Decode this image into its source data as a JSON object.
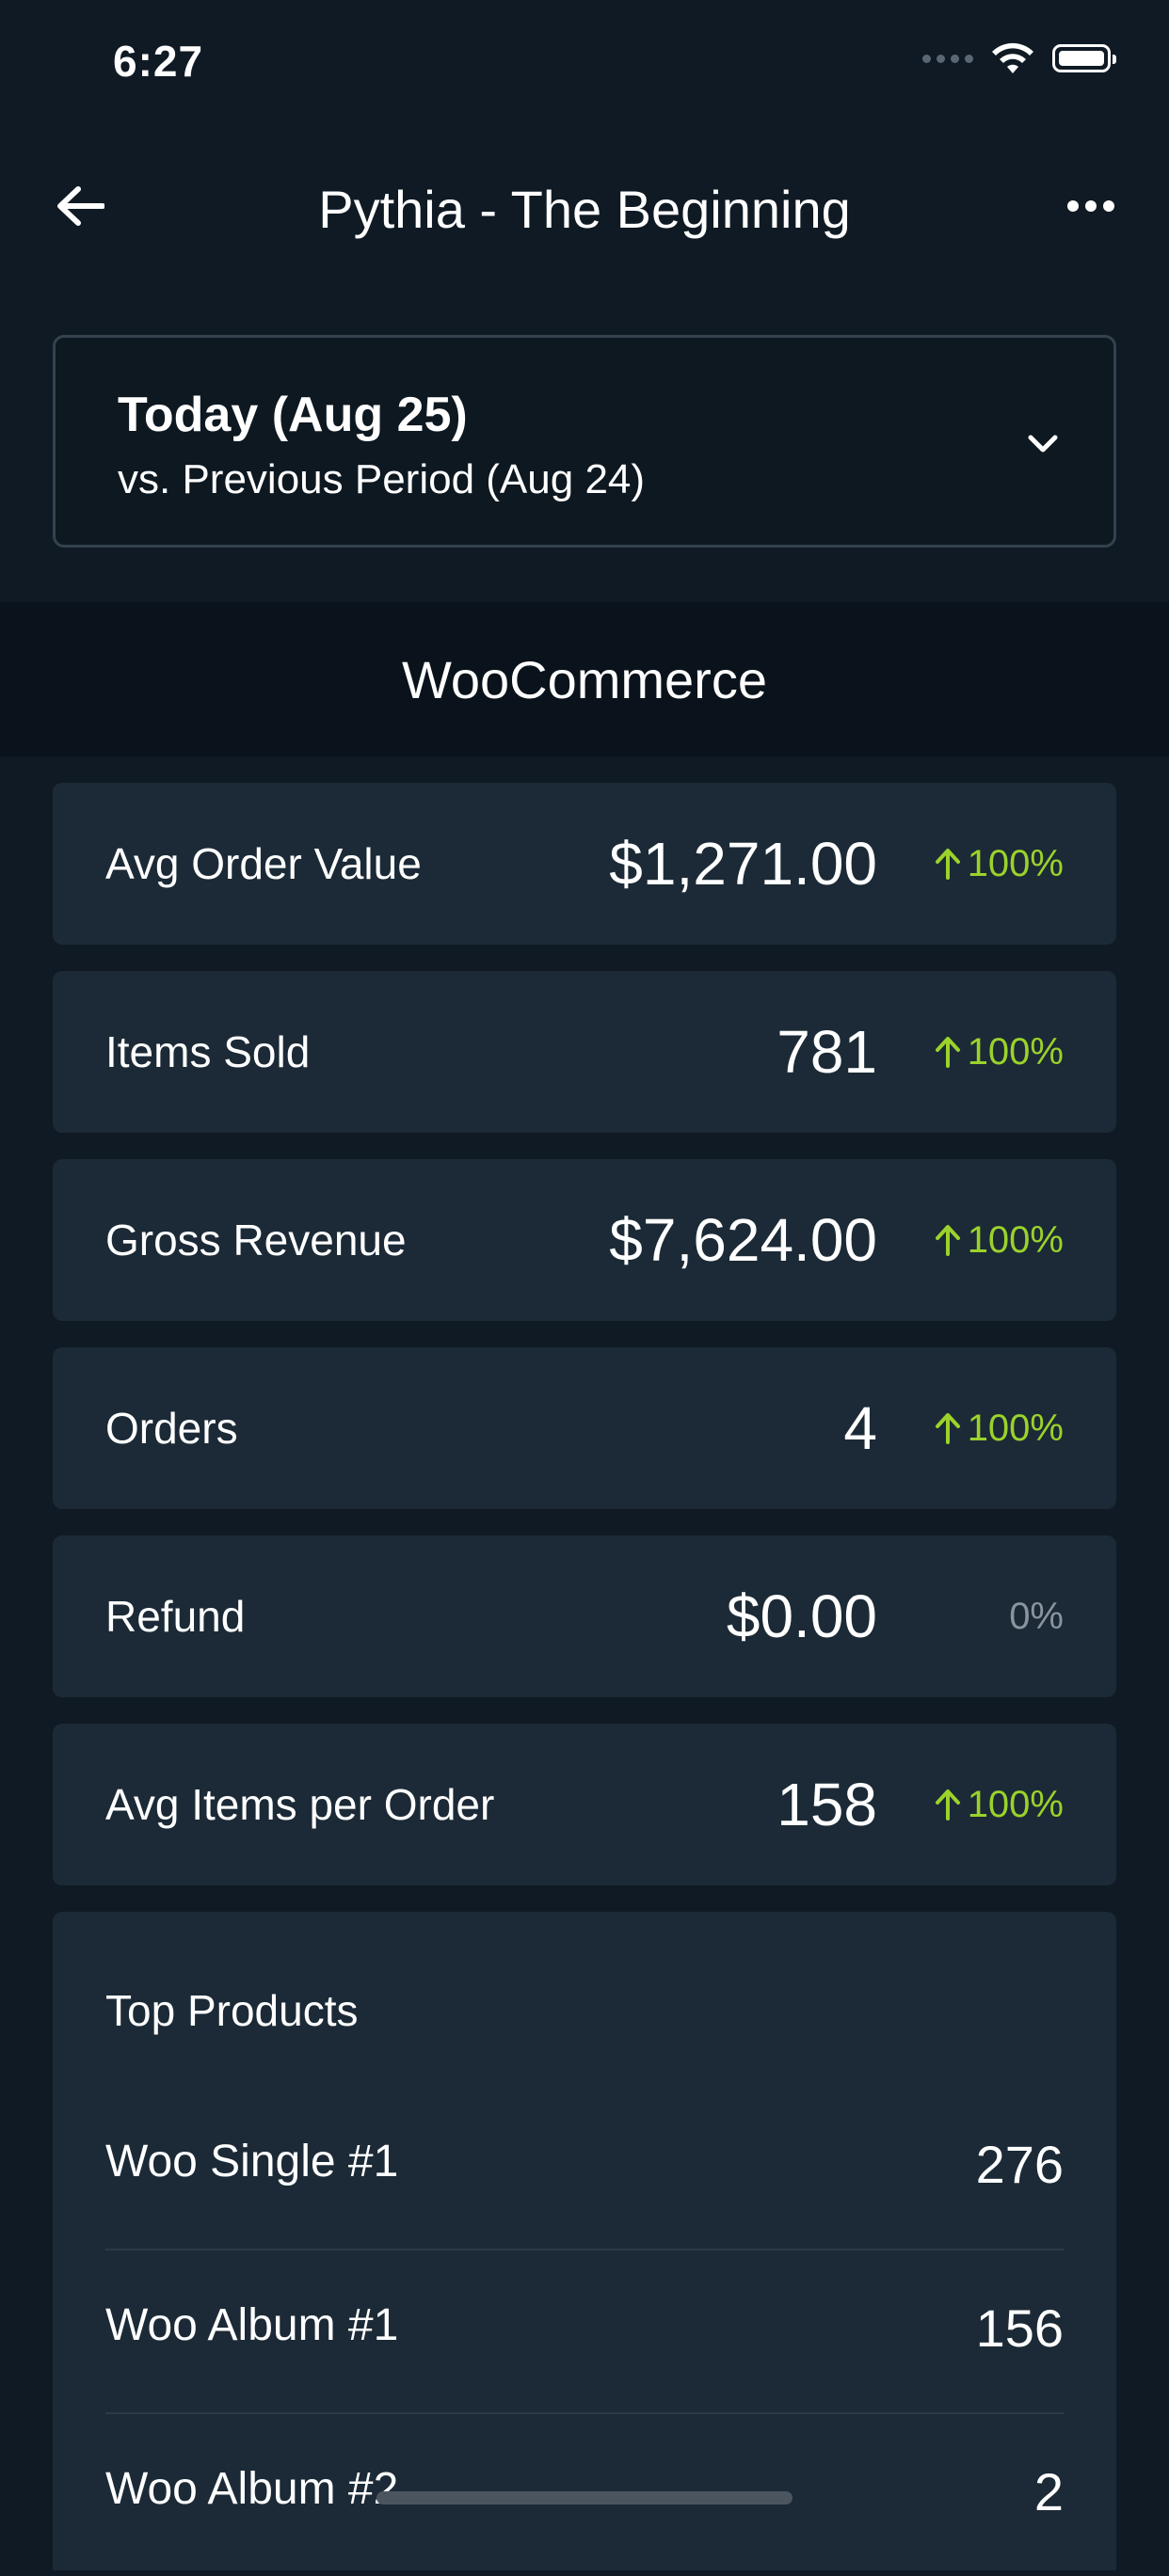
{
  "status_bar": {
    "time": "6:27"
  },
  "nav": {
    "title": "Pythia - The Beginning"
  },
  "date_picker": {
    "title": "Today (Aug 25)",
    "subtitle": "vs. Previous Period (Aug 24)"
  },
  "section": {
    "title": "WooCommerce"
  },
  "metrics": [
    {
      "label": "Avg Order Value",
      "value": "$1,271.00",
      "change": "100%",
      "direction": "up"
    },
    {
      "label": "Items Sold",
      "value": "781",
      "change": "100%",
      "direction": "up"
    },
    {
      "label": "Gross Revenue",
      "value": "$7,624.00",
      "change": "100%",
      "direction": "up"
    },
    {
      "label": "Orders",
      "value": "4",
      "change": "100%",
      "direction": "up"
    },
    {
      "label": "Refund",
      "value": "$0.00",
      "change": "0%",
      "direction": "none"
    },
    {
      "label": "Avg Items per Order",
      "value": "158",
      "change": "100%",
      "direction": "up"
    }
  ],
  "top_products": {
    "title": "Top Products",
    "items": [
      {
        "name": "Woo Single #1",
        "count": "276"
      },
      {
        "name": "Woo Album #1",
        "count": "156"
      },
      {
        "name": "Woo Album #2",
        "count": "2"
      }
    ]
  },
  "colors": {
    "positive": "#9bd22b",
    "neutral": "#8b949c",
    "background": "#0f1a24",
    "card": "#1b2a36"
  }
}
